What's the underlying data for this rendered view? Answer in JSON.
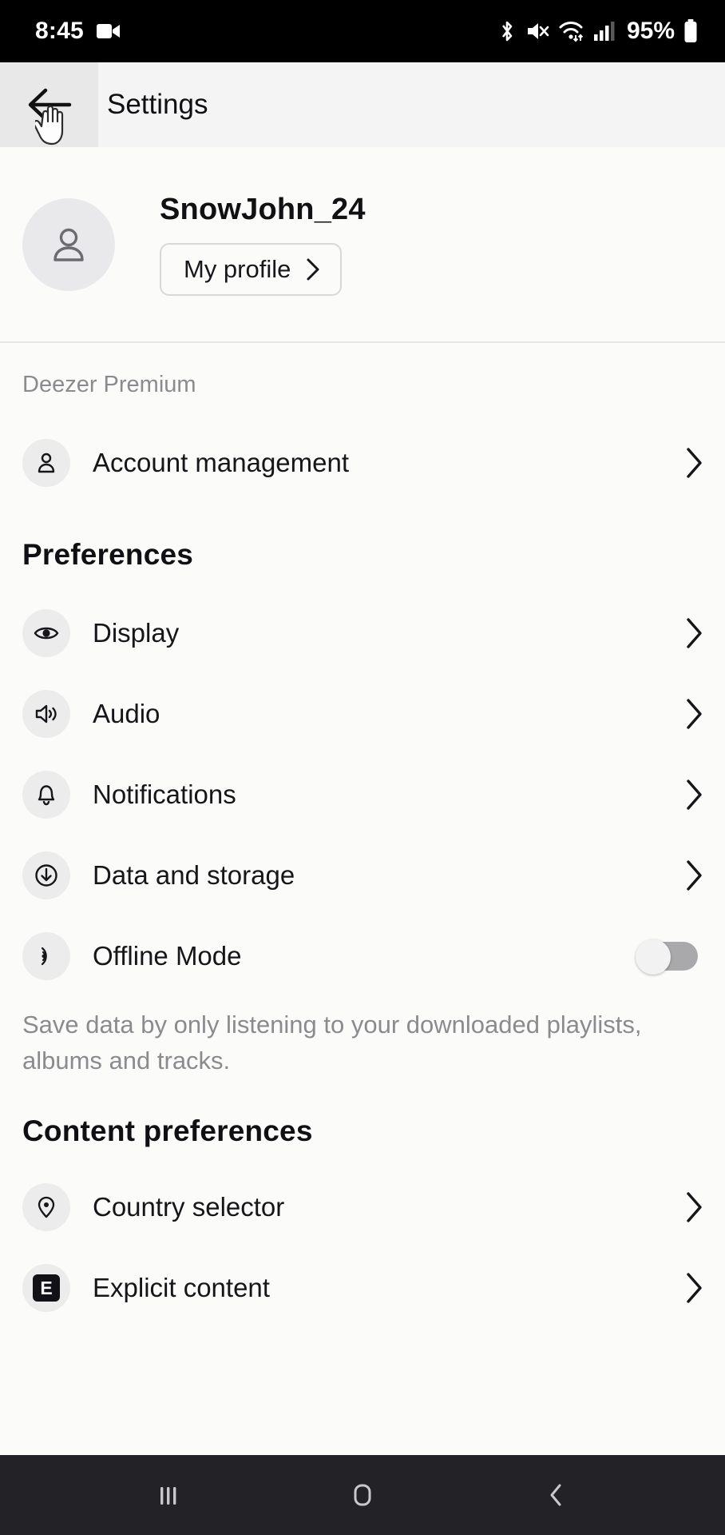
{
  "status_bar": {
    "time": "8:45",
    "battery_percent": "95%",
    "icons": [
      "video-camera-icon",
      "bluetooth-icon",
      "mute-icon",
      "wifi-icon",
      "cellular-signal-icon",
      "battery-icon"
    ]
  },
  "app_bar": {
    "back_label": "back-arrow",
    "title": "Settings"
  },
  "profile": {
    "username": "SnowJohn_24",
    "profile_button_label": "My profile",
    "avatar_icon": "person-icon"
  },
  "plan": {
    "label": "Deezer Premium"
  },
  "account_row": {
    "label": "Account management",
    "icon": "person-icon"
  },
  "preferences": {
    "title": "Preferences",
    "items": [
      {
        "label": "Display",
        "icon": "eye-icon",
        "type": "chevron"
      },
      {
        "label": "Audio",
        "icon": "speaker-icon",
        "type": "chevron"
      },
      {
        "label": "Notifications",
        "icon": "bell-icon",
        "type": "chevron"
      },
      {
        "label": "Data and storage",
        "icon": "download-icon",
        "type": "chevron"
      },
      {
        "label": "Offline Mode",
        "icon": "offline-icon",
        "type": "toggle",
        "toggle_state": "off"
      }
    ],
    "offline_helper": "Save data by only listening to your downloaded playlists, albums and tracks."
  },
  "content_preferences": {
    "title": "Content preferences",
    "items": [
      {
        "label": "Country selector",
        "icon": "map-pin-icon",
        "type": "chevron"
      },
      {
        "label": "Explicit content",
        "icon": "explicit-badge-icon",
        "type": "chevron",
        "badge_text": "E"
      }
    ]
  },
  "nav_bar": {
    "recents_label": "recents-icon",
    "home_label": "home-icon",
    "back_label": "back-icon"
  },
  "colors": {
    "background": "#fbfcfa",
    "status_bar_bg": "#000000",
    "app_bar_bg": "#f4f4f5",
    "nav_bar_bg": "#232327",
    "icon_circle_bg": "#ececed",
    "muted_text": "#8b8b8f",
    "primary_text": "#101014"
  }
}
